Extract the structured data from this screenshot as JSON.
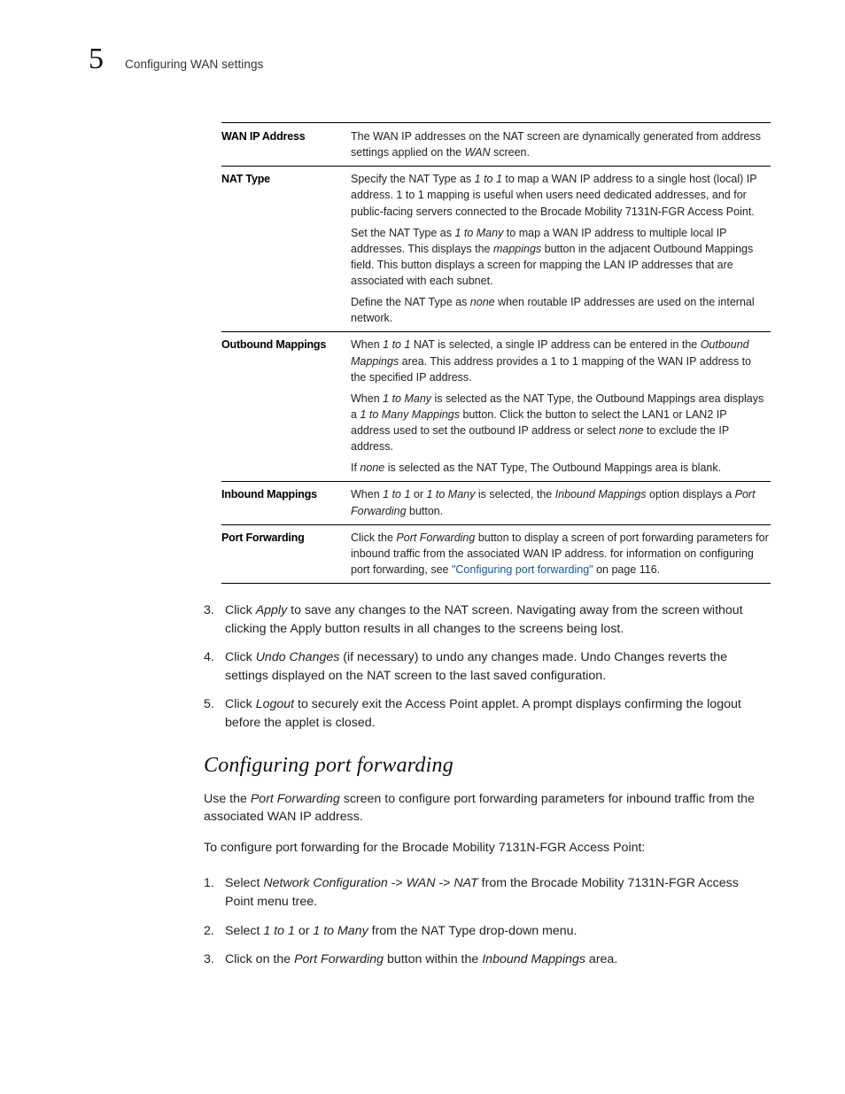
{
  "header": {
    "chapter": "5",
    "running": "Configuring WAN settings"
  },
  "table": [
    {
      "term": "WAN IP Address",
      "paras": [
        [
          {
            "t": "The WAN IP addresses on the NAT screen are dynamically generated from address settings applied on the "
          },
          {
            "t": "WAN",
            "i": true
          },
          {
            "t": " screen."
          }
        ]
      ]
    },
    {
      "term": "NAT Type",
      "paras": [
        [
          {
            "t": "Specify the NAT Type as "
          },
          {
            "t": "1 to 1",
            "i": true
          },
          {
            "t": " to map a WAN IP address to a single host (local) IP address. 1 to 1 mapping is useful when users need dedicated addresses, and for public-facing servers connected to the Brocade Mobility 7131N-FGR Access Point."
          }
        ],
        [
          {
            "t": "Set the NAT Type as "
          },
          {
            "t": "1 to Many",
            "i": true
          },
          {
            "t": " to map a WAN IP address to multiple local IP addresses. This displays the "
          },
          {
            "t": "mappings",
            "i": true
          },
          {
            "t": " button in the adjacent Outbound Mappings field. This button displays a screen for mapping the LAN IP addresses that are associated with each subnet."
          }
        ],
        [
          {
            "t": "Define the NAT Type as "
          },
          {
            "t": "none",
            "i": true
          },
          {
            "t": " when routable IP addresses are used on the internal network."
          }
        ]
      ]
    },
    {
      "term": "Outbound Mappings",
      "paras": [
        [
          {
            "t": "When "
          },
          {
            "t": "1 to 1",
            "i": true
          },
          {
            "t": " NAT is selected, a single IP address can be entered in the "
          },
          {
            "t": "Outbound Mappings",
            "i": true
          },
          {
            "t": " area. This address provides a 1 to 1 mapping of the WAN IP address to the specified IP address."
          }
        ],
        [
          {
            "t": "When "
          },
          {
            "t": "1 to Many",
            "i": true
          },
          {
            "t": " is selected as the NAT Type, the Outbound Mappings area displays a "
          },
          {
            "t": "1 to Many Mappings",
            "i": true
          },
          {
            "t": " button. Click the button to select the LAN1 or LAN2 IP address used to set the outbound IP address or select "
          },
          {
            "t": "none",
            "i": true
          },
          {
            "t": " to exclude the IP address."
          }
        ],
        [
          {
            "t": "If "
          },
          {
            "t": "none",
            "i": true
          },
          {
            "t": " is selected as the NAT Type, The Outbound Mappings area is blank."
          }
        ]
      ]
    },
    {
      "term": "Inbound Mappings",
      "paras": [
        [
          {
            "t": "When "
          },
          {
            "t": "1 to 1",
            "i": true
          },
          {
            "t": " or "
          },
          {
            "t": "1 to Many",
            "i": true
          },
          {
            "t": " is selected, the "
          },
          {
            "t": "Inbound Mappings",
            "i": true
          },
          {
            "t": " option displays a "
          },
          {
            "t": "Port Forwarding",
            "i": true
          },
          {
            "t": " button."
          }
        ]
      ]
    },
    {
      "term": "Port Forwarding",
      "paras": [
        [
          {
            "t": "Click the "
          },
          {
            "t": "Port Forwarding",
            "i": true
          },
          {
            "t": " button to display a screen of port forwarding parameters for inbound traffic from the associated WAN IP address. for information on configuring port forwarding, see "
          },
          {
            "t": "\"Configuring port forwarding\"",
            "link": true
          },
          {
            "t": " on page 116."
          }
        ]
      ]
    }
  ],
  "steps1": [
    {
      "n": "3.",
      "frags": [
        {
          "t": "Click "
        },
        {
          "t": "Apply",
          "i": true
        },
        {
          "t": " to save any changes to the NAT screen. Navigating away from the screen without clicking the Apply button results in all changes to the screens being lost."
        }
      ]
    },
    {
      "n": "4.",
      "frags": [
        {
          "t": "Click "
        },
        {
          "t": "Undo Changes",
          "i": true
        },
        {
          "t": " (if necessary) to undo any changes made. Undo Changes reverts the settings displayed on the NAT screen to the last saved configuration."
        }
      ]
    },
    {
      "n": "5.",
      "frags": [
        {
          "t": "Click "
        },
        {
          "t": "Logout",
          "i": true
        },
        {
          "t": " to securely exit the Access Point applet. A prompt displays confirming the logout before the applet is closed."
        }
      ]
    }
  ],
  "section_title": "Configuring port forwarding",
  "section_intro": [
    [
      {
        "t": "Use the "
      },
      {
        "t": "Port Forwarding",
        "i": true
      },
      {
        "t": " screen to configure port forwarding parameters for inbound traffic from the associated WAN IP address."
      }
    ],
    [
      {
        "t": "To configure port forwarding for the Brocade Mobility 7131N-FGR Access Point:"
      }
    ]
  ],
  "steps2": [
    {
      "n": "1.",
      "frags": [
        {
          "t": "Select "
        },
        {
          "t": "Network Configuration",
          "i": true
        },
        {
          "t": " -> "
        },
        {
          "t": "WAN",
          "i": true
        },
        {
          "t": " -> "
        },
        {
          "t": "NAT",
          "i": true
        },
        {
          "t": " from the Brocade Mobility 7131N-FGR Access Point menu tree."
        }
      ]
    },
    {
      "n": "2.",
      "frags": [
        {
          "t": "Select "
        },
        {
          "t": "1 to 1",
          "i": true
        },
        {
          "t": " or "
        },
        {
          "t": "1 to Many",
          "i": true
        },
        {
          "t": " from the NAT Type drop-down menu."
        }
      ]
    },
    {
      "n": "3.",
      "frags": [
        {
          "t": "Click on the "
        },
        {
          "t": "Port Forwarding",
          "i": true
        },
        {
          "t": " button within the "
        },
        {
          "t": "Inbound Mappings",
          "i": true
        },
        {
          "t": " area."
        }
      ]
    }
  ]
}
